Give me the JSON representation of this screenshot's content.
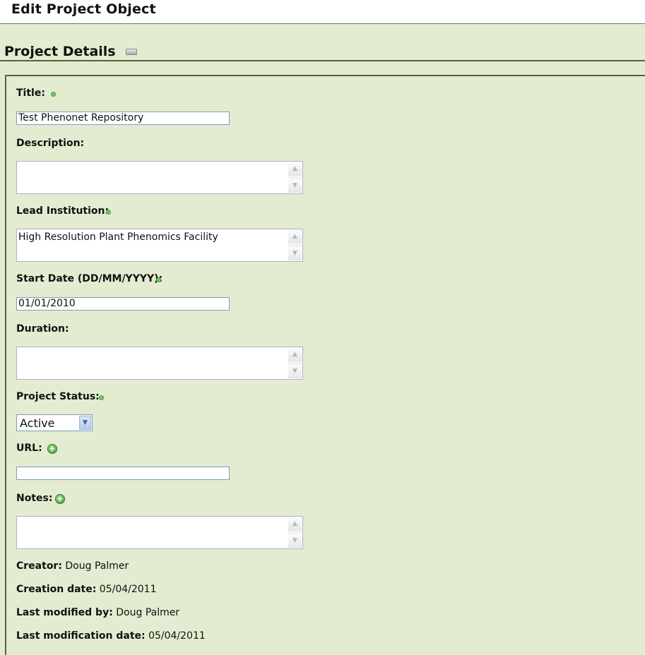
{
  "page_title": "Edit Project Object",
  "section": {
    "title": "Project Details",
    "collapse_icon": "collapse-icon"
  },
  "fields": {
    "title": {
      "label": "Title:",
      "value": "Test Phenonet Repository",
      "required": true
    },
    "description": {
      "label": "Description:",
      "value": ""
    },
    "lead_institution": {
      "label": "Lead Institution:",
      "value": "High Resolution Plant Phenomics Facility",
      "required": true
    },
    "start_date": {
      "label": "Start Date (DD/MM/YYYY):",
      "value": "01/01/2010",
      "required": true
    },
    "duration": {
      "label": "Duration:",
      "value": ""
    },
    "project_status": {
      "label": "Project Status:",
      "selected": "Active",
      "required": true
    },
    "url": {
      "label": "URL:",
      "value": "",
      "add_icon": "add-icon"
    },
    "notes": {
      "label": "Notes:",
      "value": "",
      "add_icon": "add-icon"
    }
  },
  "metadata": {
    "creator_label": "Creator:",
    "creator": "Doug Palmer",
    "creation_date_label": "Creation date:",
    "creation_date": "05/04/2011",
    "last_modified_by_label": "Last modified by:",
    "last_modified_by": "Doug Palmer",
    "last_modification_date_label": "Last modification date:",
    "last_modification_date": "05/04/2011"
  },
  "colors": {
    "background": "#e3ecd0",
    "rule": "#55623e",
    "required_dot": "#7cc46d"
  }
}
